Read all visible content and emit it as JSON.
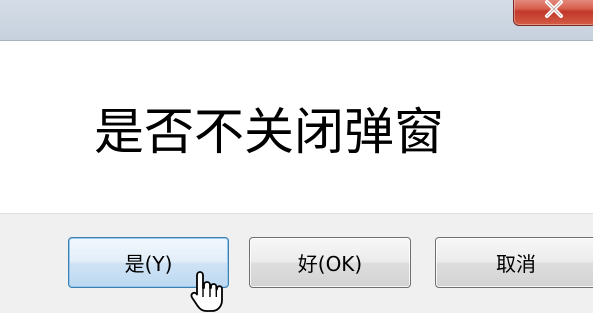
{
  "dialog": {
    "message": "是否不关闭弹窗"
  },
  "buttons": {
    "yes_label": "是(Y)",
    "ok_label": "好(OK)",
    "cancel_label": "取消"
  },
  "colors": {
    "close_button": "#d8604f",
    "default_button_border": "#3c7fb1",
    "button_bar": "#f0f0f0"
  },
  "icons": {
    "close": "close-icon",
    "cursor": "hand-pointer-icon"
  }
}
